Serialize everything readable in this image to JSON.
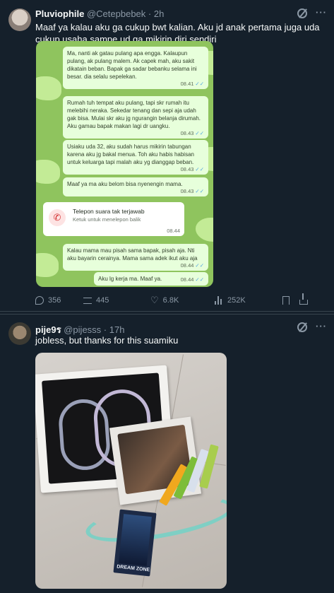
{
  "tweet1": {
    "name": "Pluviophile",
    "handle": "@Cetepbebek",
    "dot": "·",
    "time": "2h",
    "text": "Maaf ya kalau aku ga cukup bwt kalian. Aku jd anak pertama juga uda cukup usaha sampe ud ga mikirin diri sendiri",
    "chat": {
      "bubbles": [
        {
          "text": "Ma, nanti ak gatau pulang apa engga. Kalaupun pulang, ak pulang malem. Ak capek mah, aku sakit dikatain beban. Bapak ga sadar bebanku selama ini besar. dia selalu sepelekan.",
          "time": "08.41"
        },
        {
          "text": "Rumah tuh tempat aku pulang, tapi skr rumah itu melebihi neraka. Sekedar tenang dan sepi aja udah gak bisa. Mulai skr aku jg ngurangin belanja dirumah. Aku gamau bapak makan lagi dr uangku.",
          "time": "08.43"
        },
        {
          "text": "Usiaku uda 32, aku sudah harus mikirin tabungan karena aku jg bakal menua. Toh aku habis habisan untuk keluarga tapi malah aku yg dianggap beban.",
          "time": "08.43"
        },
        {
          "text": "Maaf ya ma aku belom bisa nyenengin mama.",
          "time": "08.43"
        },
        {
          "text": "Kalau mama mau pisah sama bapak, pisah aja. Nti aku bayarin cerainya. Mama sama adek ikut aku aja",
          "time": "08.44"
        },
        {
          "text": "Aku lg kerja ma. Maaf ya.",
          "time": "08.44"
        }
      ],
      "call": {
        "title": "Telepon suara tak terjawab",
        "subtitle": "Ketuk untuk menelepon balik",
        "time": "08.44"
      },
      "tick": "✓✓"
    },
    "stats": {
      "replies": "356",
      "retweets": "445",
      "likes": "6.8K",
      "views": "252K"
    }
  },
  "tweet2": {
    "name": "pije9ร",
    "handle": "@pijesss",
    "dot": "·",
    "time": "17h",
    "text": "jobless, but thanks for this suamiku",
    "photo_labels": {
      "card": "DREAM ZONE"
    }
  },
  "icons": {
    "more": "···",
    "like": "♡",
    "phone": "✆"
  }
}
